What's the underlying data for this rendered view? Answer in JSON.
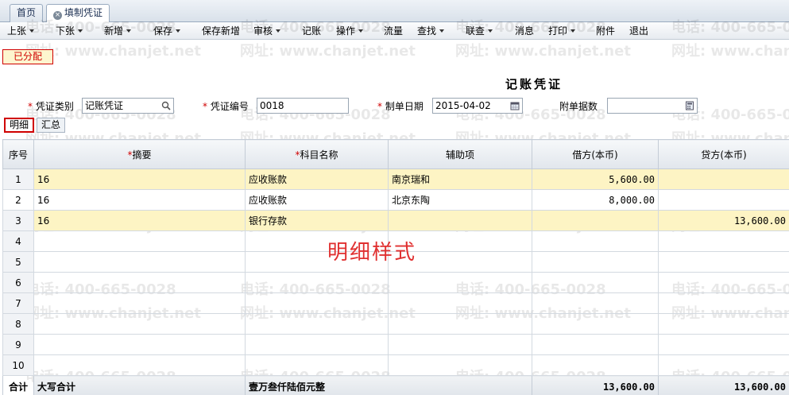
{
  "tabs": [
    {
      "label": "首页"
    },
    {
      "label": "填制凭证"
    }
  ],
  "toolbar": [
    {
      "label": "上张",
      "dropdown": true
    },
    {
      "label": "下张",
      "dropdown": true
    },
    {
      "label": "新增",
      "dropdown": true
    },
    {
      "label": "保存",
      "dropdown": true
    },
    {
      "label": "保存新增",
      "dropdown": false
    },
    {
      "label": "审核",
      "dropdown": true
    },
    {
      "label": "记账",
      "dropdown": false
    },
    {
      "label": "操作",
      "dropdown": true
    },
    {
      "label": "流量",
      "dropdown": false
    },
    {
      "label": "查找",
      "dropdown": true
    },
    {
      "label": "联查",
      "dropdown": true
    },
    {
      "label": "消息",
      "dropdown": false
    },
    {
      "label": "打印",
      "dropdown": true
    },
    {
      "label": "附件",
      "dropdown": false
    },
    {
      "label": "退出",
      "dropdown": false
    }
  ],
  "status_badge": "已分配",
  "voucher_title": "记账凭证",
  "form": {
    "type_label": "凭证类别",
    "type_value": "记账凭证",
    "number_label": "凭证编号",
    "number_value": "0018",
    "date_label": "制单日期",
    "date_value": "2015-04-02",
    "attach_label": "附单据数",
    "attach_value": ""
  },
  "subtabs": [
    {
      "label": "明细"
    },
    {
      "label": "汇总"
    }
  ],
  "grid": {
    "headers": {
      "seq": "序号",
      "summary": "摘要",
      "account": "科目名称",
      "aux": "辅助项",
      "debit": "借方(本币)",
      "credit": "贷方(本币)"
    },
    "rows": [
      {
        "seq": "1",
        "summary": "16",
        "account": "应收账款",
        "aux": "南京瑞和",
        "debit": "5,600.00",
        "credit": ""
      },
      {
        "seq": "2",
        "summary": "16",
        "account": "应收账款",
        "aux": "北京东陶",
        "debit": "8,000.00",
        "credit": ""
      },
      {
        "seq": "3",
        "summary": "16",
        "account": "银行存款",
        "aux": "",
        "debit": "",
        "credit": "13,600.00"
      },
      {
        "seq": "4",
        "summary": "",
        "account": "",
        "aux": "",
        "debit": "",
        "credit": ""
      },
      {
        "seq": "5",
        "summary": "",
        "account": "",
        "aux": "",
        "debit": "",
        "credit": ""
      },
      {
        "seq": "6",
        "summary": "",
        "account": "",
        "aux": "",
        "debit": "",
        "credit": ""
      },
      {
        "seq": "7",
        "summary": "",
        "account": "",
        "aux": "",
        "debit": "",
        "credit": ""
      },
      {
        "seq": "8",
        "summary": "",
        "account": "",
        "aux": "",
        "debit": "",
        "credit": ""
      },
      {
        "seq": "9",
        "summary": "",
        "account": "",
        "aux": "",
        "debit": "",
        "credit": ""
      },
      {
        "seq": "10",
        "summary": "",
        "account": "",
        "aux": "",
        "debit": "",
        "credit": ""
      }
    ],
    "total": {
      "label": "合计",
      "caps_label": "大写合计",
      "caps_value": "壹万叁仟陆佰元整",
      "debit": "13,600.00",
      "credit": "13,600.00"
    }
  },
  "annotation": "明细样式",
  "watermark": {
    "phone": "电话: 400-665-0028",
    "site": "网址: www.chanjet.net"
  },
  "colors": {
    "required": "#d00000",
    "highlight_row": "#fdf4c4",
    "annotation": "#e03030"
  }
}
